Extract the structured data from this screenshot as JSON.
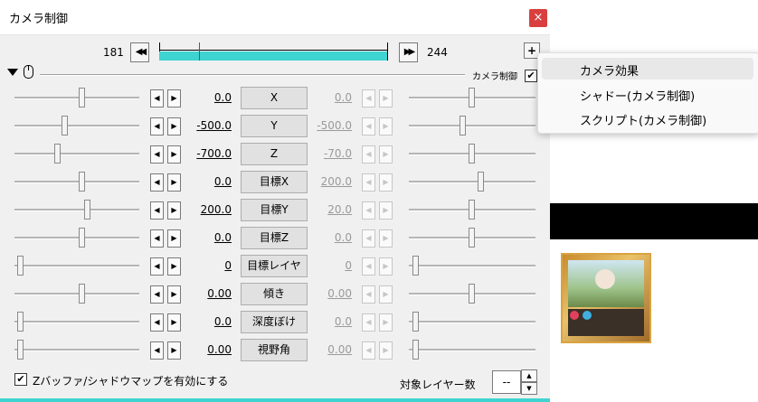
{
  "window": {
    "title": "カメラ制御",
    "close_label": "×"
  },
  "frames": {
    "start": "181",
    "end": "244",
    "prev_icon": "◀◀",
    "next_icon": "▶▶",
    "plus_label": "+",
    "progress": 0.17
  },
  "header": {
    "camera_control_label": "カメラ制御",
    "camera_control_checked": "✔"
  },
  "params": [
    {
      "label": "X",
      "left_value": "0.0",
      "right_value": "0.0"
    },
    {
      "label": "Y",
      "left_value": "-500.0",
      "right_value": "-500.0"
    },
    {
      "label": "Z",
      "left_value": "-700.0",
      "right_value": "-70.0"
    },
    {
      "label": "目標X",
      "left_value": "0.0",
      "right_value": "200.0"
    },
    {
      "label": "目標Y",
      "left_value": "200.0",
      "right_value": "20.0"
    },
    {
      "label": "目標Z",
      "left_value": "0.0",
      "right_value": "0.0"
    },
    {
      "label": "目標レイヤ",
      "left_value": "0",
      "right_value": "0"
    },
    {
      "label": "傾き",
      "left_value": "0.00",
      "right_value": "0.00"
    },
    {
      "label": "深度ぼけ",
      "left_value": "0.0",
      "right_value": "0.0"
    },
    {
      "label": "視野角",
      "left_value": "0.00",
      "right_value": "0.00"
    }
  ],
  "arrows": {
    "left": "◀",
    "right": "▶"
  },
  "bottom": {
    "zbuffer_label": "Zバッファ/シャドウマップを有効にする",
    "zbuffer_checked": "✔",
    "target_layers_label": "対象レイヤー数",
    "target_layers_value": "--"
  },
  "menu": {
    "items": [
      "カメラ効果",
      "シャドー(カメラ制御)",
      "スクリプト(カメラ制御)"
    ]
  },
  "colors": {
    "accent": "#3fd3d1",
    "close": "#d93f3f",
    "marker": "#e02020"
  }
}
